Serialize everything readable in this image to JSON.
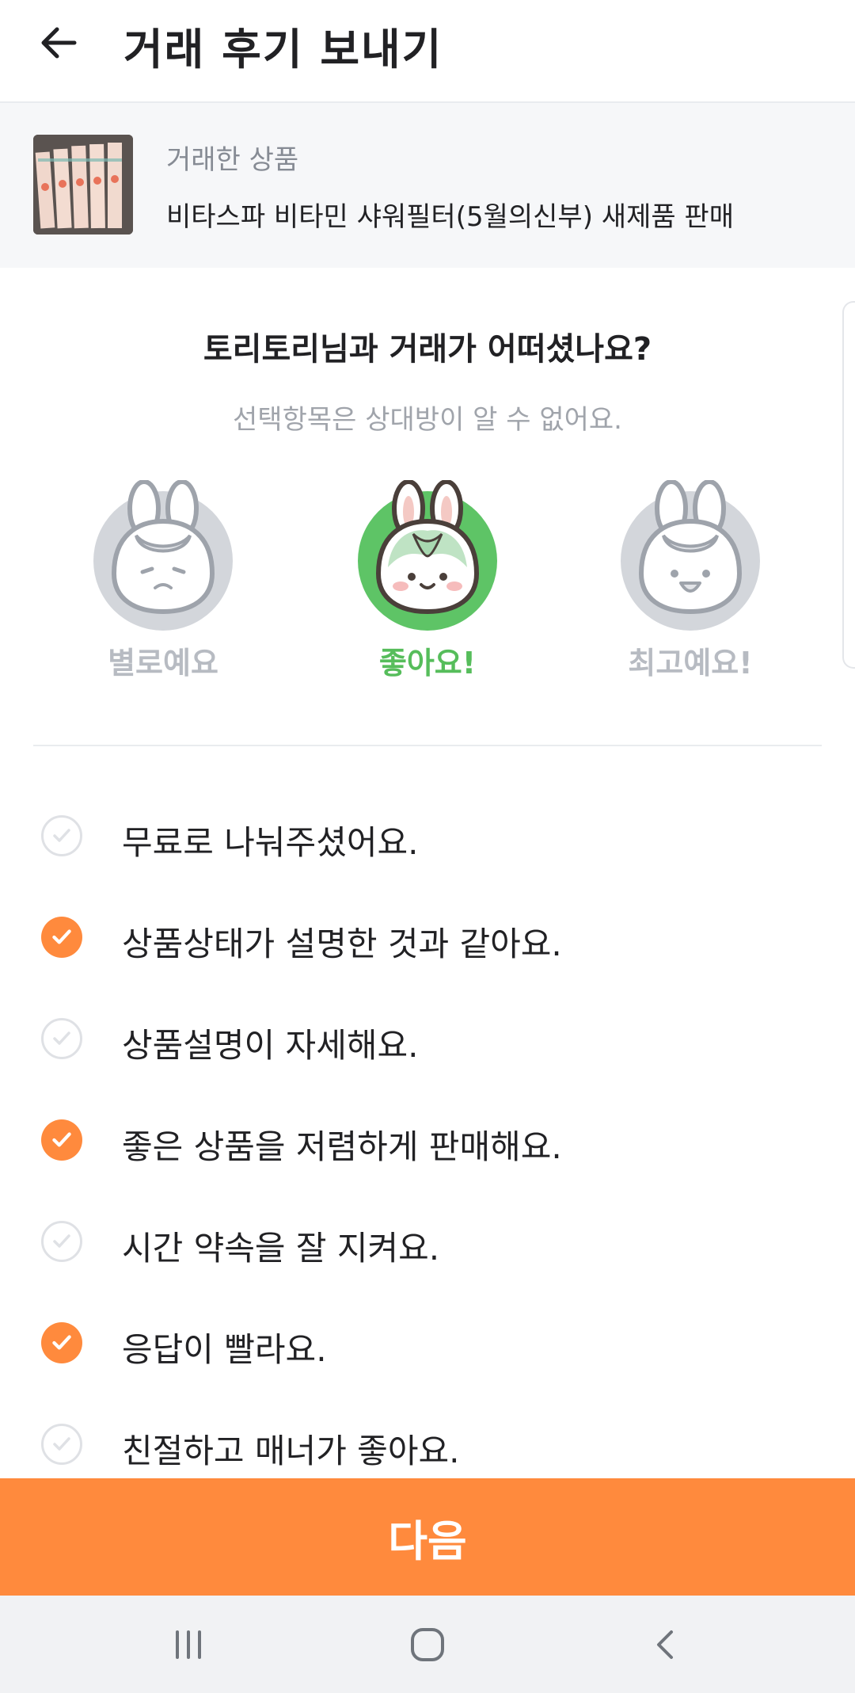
{
  "header": {
    "title": "거래 후기 보내기",
    "back_icon": "arrow-left-icon"
  },
  "product": {
    "label": "거래한 상품",
    "name": "비타스파 비타민 샤워필터(5월의신부) 새제품 판매"
  },
  "question": {
    "title": "토리토리님과 거래가 어떠셨나요?",
    "subtext": "선택항목은 상대방이 알 수 없어요."
  },
  "ratings": [
    {
      "label": "별로예요",
      "icon": "sad-bunny-icon",
      "selected": false
    },
    {
      "label": "좋아요!",
      "icon": "happy-bunny-icon",
      "selected": true
    },
    {
      "label": "최고예요!",
      "icon": "excited-bunny-icon",
      "selected": false
    }
  ],
  "checklist": [
    {
      "label": "무료로 나눠주셨어요.",
      "checked": false
    },
    {
      "label": "상품상태가 설명한 것과 같아요.",
      "checked": true
    },
    {
      "label": "상품설명이 자세해요.",
      "checked": false
    },
    {
      "label": "좋은 상품을 저렴하게 판매해요.",
      "checked": true
    },
    {
      "label": "시간 약속을 잘 지켜요.",
      "checked": false
    },
    {
      "label": "응답이 빨라요.",
      "checked": true
    },
    {
      "label": "친절하고 매너가 좋아요.",
      "checked": false
    }
  ],
  "next_button": {
    "label": "다음"
  },
  "colors": {
    "accent": "#ff8a3d",
    "selected_green": "#56bd5b",
    "inactive_gray": "#b7bbc2"
  },
  "system_nav": {
    "recents_icon": "recents-icon",
    "home_icon": "home-icon",
    "back_icon": "chevron-left-icon"
  }
}
